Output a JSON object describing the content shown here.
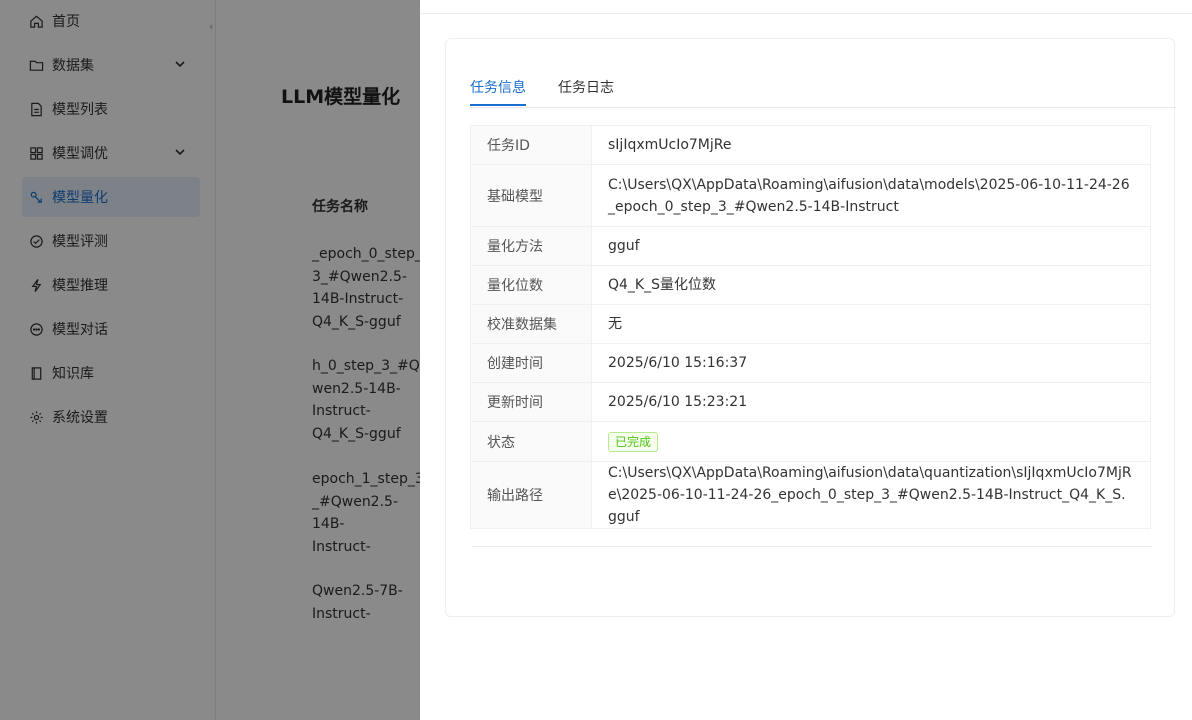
{
  "sidebar": {
    "items": [
      {
        "label": "首页",
        "icon": "home-icon"
      },
      {
        "label": "数据集",
        "icon": "folder-icon",
        "expandable": true
      },
      {
        "label": "模型列表",
        "icon": "file-list-icon"
      },
      {
        "label": "模型调优",
        "icon": "grid-icon",
        "expandable": true
      },
      {
        "label": "模型量化",
        "icon": "quantize-icon",
        "active": true
      },
      {
        "label": "模型评测",
        "icon": "check-circle-icon"
      },
      {
        "label": "模型推理",
        "icon": "lightning-icon"
      },
      {
        "label": "模型对话",
        "icon": "chat-icon"
      },
      {
        "label": "知识库",
        "icon": "book-icon"
      },
      {
        "label": "系统设置",
        "icon": "gear-icon"
      }
    ]
  },
  "main": {
    "title": "LLM模型量化",
    "table": {
      "header": "任务名称",
      "rows": [
        "_epoch_0_step_\n3_#Qwen2.5-\n14B-Instruct-\nQ4_K_S-gguf",
        "h_0_step_3_#Q\nwen2.5-14B-\nInstruct-\nQ4_K_S-gguf",
        "epoch_1_step_3\n_#Qwen2.5-14B-\nInstruct-\nQ4_K_S-gguf",
        "Qwen2.5-7B-\nInstruct-"
      ]
    }
  },
  "drawer": {
    "tabs": [
      "任务信息",
      "任务日志"
    ],
    "active_tab": 0,
    "details": [
      {
        "key": "任务ID",
        "value": "sIjIqxmUcIo7MjRe"
      },
      {
        "key": "基础模型",
        "value": "C:\\Users\\QX\\AppData\\Roaming\\aifusion\\data\\models\\2025-06-10-11-24-26_epoch_0_step_3_#Qwen2.5-14B-Instruct"
      },
      {
        "key": "量化方法",
        "value": "gguf"
      },
      {
        "key": "量化位数",
        "value": "Q4_K_S量化位数"
      },
      {
        "key": "校准数据集",
        "value": "无"
      },
      {
        "key": "创建时间",
        "value": "2025/6/10 15:16:37"
      },
      {
        "key": "更新时间",
        "value": "2025/6/10 15:23:21"
      },
      {
        "key": "状态",
        "value": "已完成"
      },
      {
        "key": "输出路径",
        "value": "C:\\Users\\QX\\AppData\\Roaming\\aifusion\\data\\quantization\\sIjIqxmUcIo7MjRe\\2025-06-10-11-24-26_epoch_0_step_3_#Qwen2.5-14B-Instruct_Q4_K_S.gguf"
      }
    ]
  },
  "colors": {
    "accent": "#1a6fce",
    "status_success": "#52c41a",
    "overlay": "#000000"
  }
}
